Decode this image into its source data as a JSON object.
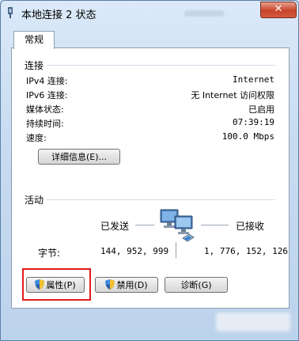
{
  "window": {
    "title": "本地连接 2 状态",
    "close_label": "✕"
  },
  "tabs": [
    {
      "label": "常规",
      "active": true
    }
  ],
  "connection": {
    "heading": "连接",
    "rows": [
      {
        "label": "IPv4 连接:",
        "value": "Internet"
      },
      {
        "label": "IPv6 连接:",
        "value": "无 Internet 访问权限"
      },
      {
        "label": "媒体状态:",
        "value": "已启用"
      },
      {
        "label": "持续时间:",
        "value": "07:39:19"
      },
      {
        "label": "速度:",
        "value": "100.0 Mbps"
      }
    ],
    "details_button": "详细信息(E)..."
  },
  "activity": {
    "heading": "活动",
    "sent_label": "已发送",
    "received_label": "已接收",
    "bytes_label": "字节:",
    "bytes_sent": "144, 952, 999",
    "bytes_received": "1, 776, 152, 126"
  },
  "buttons": {
    "properties": "属性(P)",
    "disable": "禁用(D)",
    "diagnose": "诊断(G)"
  },
  "colors": {
    "highlight_box": "#e31b1b",
    "shield_blue": "#2a5ea8",
    "shield_yellow": "#f2c12e"
  }
}
